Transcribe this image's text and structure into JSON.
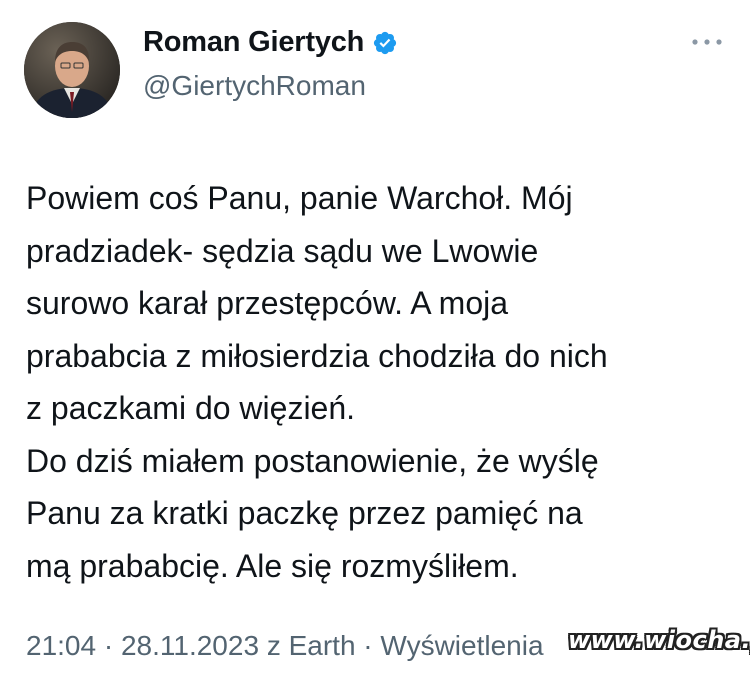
{
  "author": {
    "display_name": "Roman Giertych",
    "handle": "@GiertychRoman",
    "verified": true,
    "avatar_icon": "profile-photo",
    "verified_icon": "verified-badge-icon",
    "more_icon": "more-options-icon"
  },
  "tweet": {
    "lines": [
      "Powiem coś Panu, panie Warchoł. Mój",
      "pradziadek- sędzia sądu we Lwowie",
      "surowo karał przestępców. A moja",
      "prababcia z miłosierdzia chodziła do nich",
      "z paczkami do więzień.",
      "Do dziś miałem postanowienie, że wyślę",
      "Panu za kratki paczkę przez pamięć na",
      "mą prababcię. Ale się rozmyśliłem."
    ]
  },
  "meta": {
    "time": "21:04",
    "separator": "·",
    "date": "28.11.2023",
    "source": "z Earth",
    "views_label": "Wyświetlenia"
  },
  "watermark": {
    "text": "www.wiocha.pl"
  },
  "colors": {
    "text_primary": "#0f1419",
    "text_secondary": "#536471",
    "verified_blue": "#1d9bf0",
    "background": "#ffffff"
  }
}
